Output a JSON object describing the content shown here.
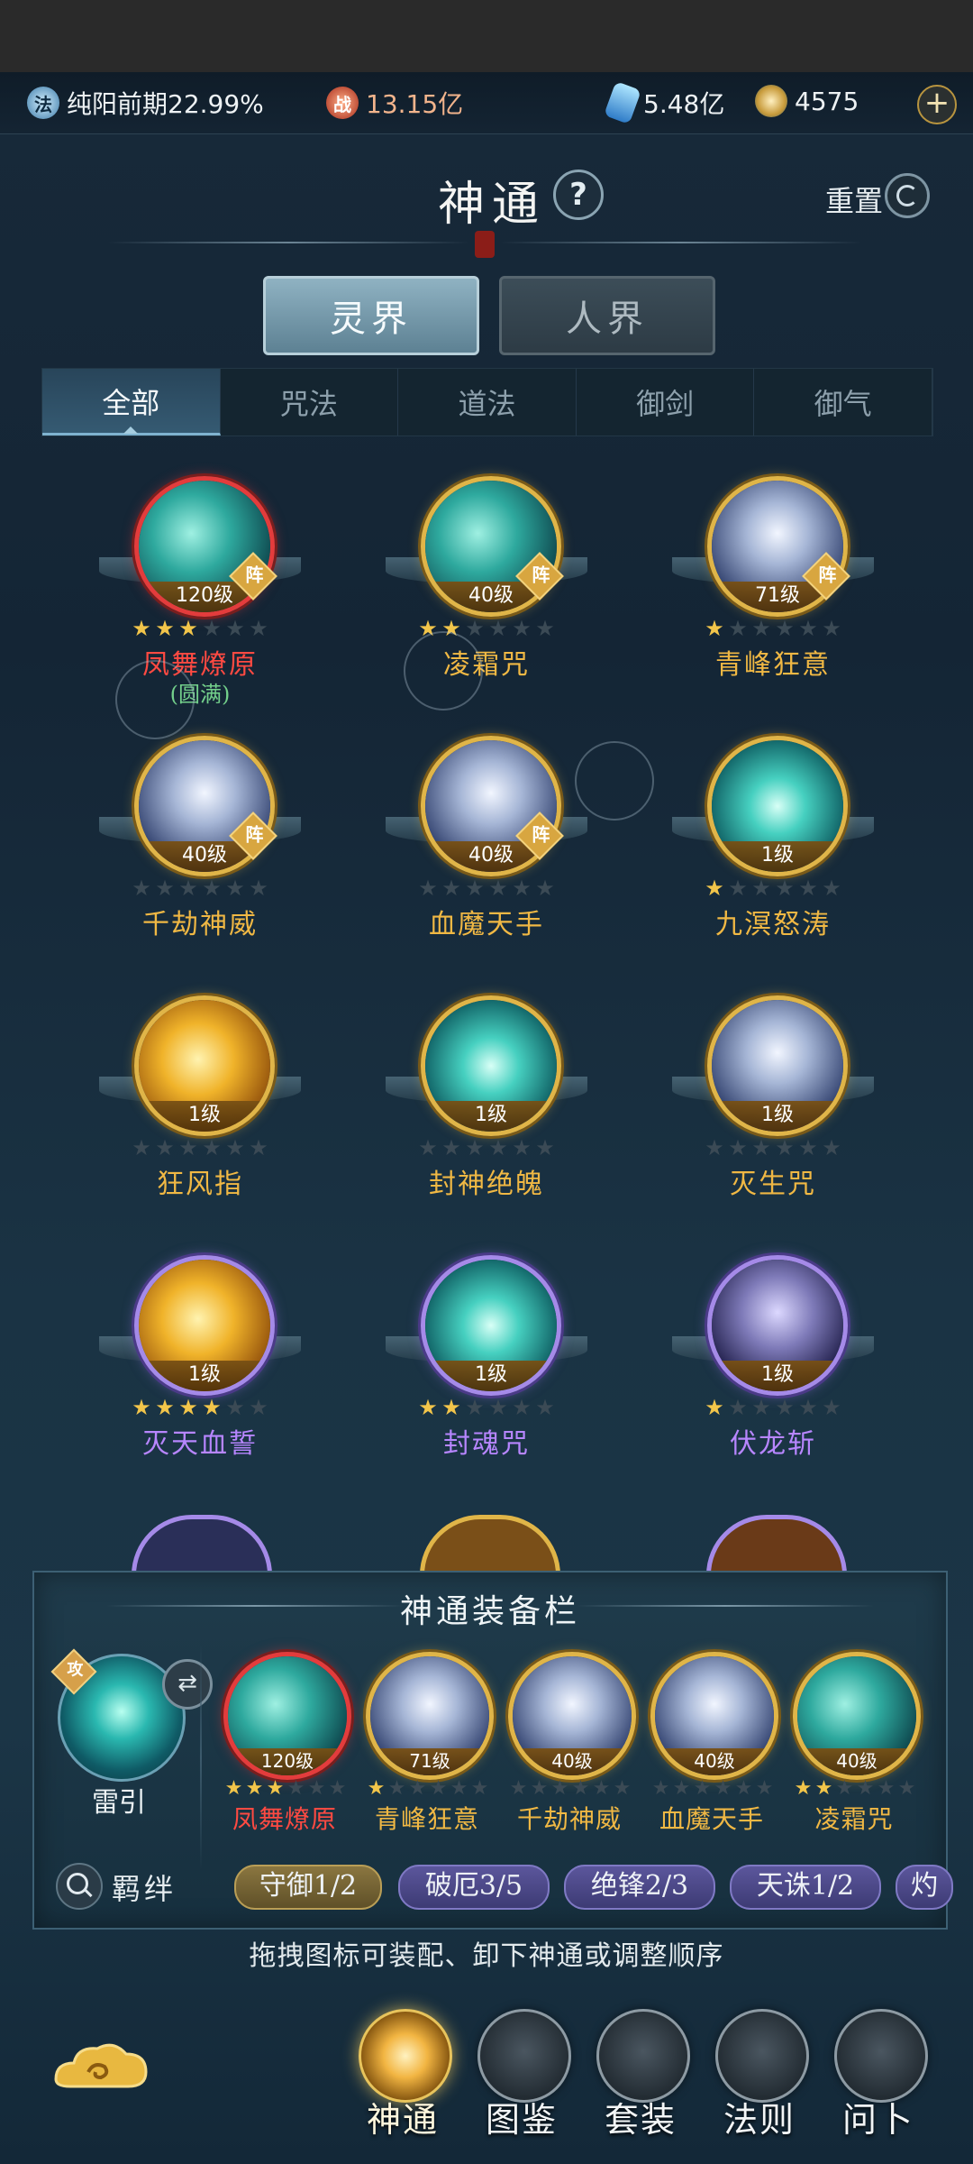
{
  "topbar": {
    "cultivation_icon": "法",
    "cultivation": "纯阳前期22.99%",
    "power_icon": "战",
    "power": "13.15亿",
    "crystal": "5.48亿",
    "coin": "4575"
  },
  "header": {
    "title": "神通",
    "help": "?",
    "reset": "重置"
  },
  "realms": [
    "灵界",
    "人界"
  ],
  "categories": [
    "全部",
    "咒法",
    "道法",
    "御剑",
    "御气"
  ],
  "skills": [
    {
      "name": "凤舞燎原",
      "level": "120级",
      "tag": "阵",
      "stars": 3,
      "sub": "(圆满)",
      "frame": "red",
      "name_color": "red",
      "art": "cyan"
    },
    {
      "name": "凌霜咒",
      "level": "40级",
      "tag": "阵",
      "stars": 2,
      "frame": "gold",
      "name_color": "gold",
      "art": "cyan"
    },
    {
      "name": "青峰狂意",
      "level": "71级",
      "tag": "阵",
      "stars": 1,
      "frame": "gold",
      "name_color": "gold",
      "art": "white"
    },
    {
      "name": "千劫神威",
      "level": "40级",
      "tag": "阵",
      "stars": 0,
      "frame": "gold",
      "name_color": "gold",
      "art": "white"
    },
    {
      "name": "血魔天手",
      "level": "40级",
      "tag": "阵",
      "stars": 0,
      "frame": "gold",
      "name_color": "gold",
      "art": "white"
    },
    {
      "name": "九溟怒涛",
      "level": "1级",
      "tag": "",
      "stars": 1,
      "frame": "gold",
      "name_color": "gold",
      "art": "teal"
    },
    {
      "name": "狂风指",
      "level": "1级",
      "tag": "",
      "stars": 0,
      "frame": "gold",
      "name_color": "gold",
      "art": "gold"
    },
    {
      "name": "封神绝魄",
      "level": "1级",
      "tag": "",
      "stars": 0,
      "frame": "gold",
      "name_color": "gold",
      "art": "teal"
    },
    {
      "name": "灭生咒",
      "level": "1级",
      "tag": "",
      "stars": 0,
      "frame": "gold",
      "name_color": "gold",
      "art": "white"
    },
    {
      "name": "灭天血誓",
      "level": "1级",
      "tag": "",
      "stars": 4,
      "frame": "purple",
      "name_color": "purple",
      "art": "gold"
    },
    {
      "name": "封魂咒",
      "level": "1级",
      "tag": "",
      "stars": 2,
      "frame": "purple",
      "name_color": "purple",
      "art": "teal"
    },
    {
      "name": "伏龙斩",
      "level": "1级",
      "tag": "",
      "stars": 1,
      "frame": "purple",
      "name_color": "purple",
      "art": "purple"
    }
  ],
  "equip": {
    "title": "神通装备栏",
    "main_tag": "攻",
    "main_name": "雷引",
    "slots": [
      {
        "name": "凤舞燎原",
        "level": "120级",
        "stars": 3,
        "frame": "red",
        "name_color": "red",
        "art": "cyan"
      },
      {
        "name": "青峰狂意",
        "level": "71级",
        "stars": 1,
        "frame": "gold",
        "name_color": "gold",
        "art": "white"
      },
      {
        "name": "千劫神威",
        "level": "40级",
        "stars": 0,
        "frame": "gold",
        "name_color": "gold",
        "art": "white"
      },
      {
        "name": "血魔天手",
        "level": "40级",
        "stars": 0,
        "frame": "gold",
        "name_color": "gold",
        "art": "white"
      },
      {
        "name": "凌霜咒",
        "level": "40级",
        "stars": 2,
        "frame": "gold",
        "name_color": "gold",
        "art": "cyan"
      }
    ],
    "bond_label": "羁绊",
    "bonds": [
      {
        "text": "守御1/2",
        "style": "gold"
      },
      {
        "text": "破厄3/5",
        "style": "purple"
      },
      {
        "text": "绝锋2/3",
        "style": "purple"
      },
      {
        "text": "天诛1/2",
        "style": "purple"
      },
      {
        "text": "灼",
        "style": "purple"
      }
    ]
  },
  "hint": "拖拽图标可装配、卸下神通或调整顺序",
  "nav": [
    {
      "label": "神通",
      "icon": "flame-icon",
      "active": true
    },
    {
      "label": "图鉴",
      "icon": "book-icon",
      "active": false
    },
    {
      "label": "套装",
      "icon": "fan-icon",
      "active": false
    },
    {
      "label": "法则",
      "icon": "rune-icon",
      "active": false
    },
    {
      "label": "问卜",
      "icon": "divination-icon",
      "active": false
    }
  ],
  "colors": {
    "gold": "#f0b844",
    "red": "#ff4a42",
    "purple": "#b786ff",
    "accent": "#7fb3d0"
  }
}
